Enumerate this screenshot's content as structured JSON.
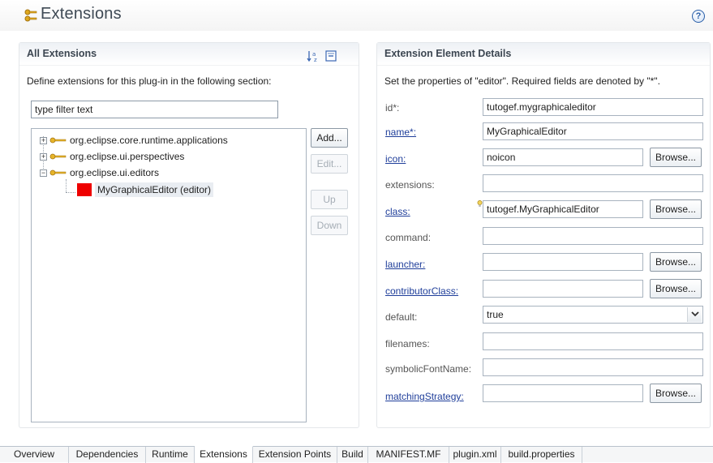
{
  "header": {
    "title": "Extensions",
    "help_icon": "help-icon"
  },
  "left": {
    "heading": "All Extensions",
    "description": "Define extensions for this plug-in in the following section:",
    "filter_value": "type filter text",
    "tree": {
      "items": [
        {
          "label": "org.eclipse.core.runtime.applications",
          "expanded": false
        },
        {
          "label": "org.eclipse.ui.perspectives",
          "expanded": false
        },
        {
          "label": "org.eclipse.ui.editors",
          "expanded": true
        }
      ],
      "child": {
        "label": "MyGraphicalEditor (editor)",
        "icon_color": "#ee0000"
      }
    },
    "buttons": {
      "add": "Add...",
      "edit": "Edit...",
      "up": "Up",
      "down": "Down"
    }
  },
  "right": {
    "heading": "Extension Element Details",
    "description": "Set the properties of \"editor\". Required fields are denoted by \"*\".",
    "fields": [
      {
        "label": "id*:",
        "value": "tutogef.mygraphicaleditor"
      },
      {
        "label": "name*:",
        "value": "MyGraphicalEditor"
      },
      {
        "label": "icon:",
        "value": "noicon"
      },
      {
        "label": "extensions:",
        "value": ""
      },
      {
        "label": "class:",
        "value": "tutogef.MyGraphicalEditor"
      },
      {
        "label": "command:",
        "value": ""
      },
      {
        "label": "launcher:",
        "value": ""
      },
      {
        "label": "contributorClass:",
        "value": ""
      },
      {
        "label": "default:",
        "value": "true"
      },
      {
        "label": "filenames:",
        "value": ""
      },
      {
        "label": "symbolicFontName:",
        "value": ""
      },
      {
        "label": "matchingStrategy:",
        "value": ""
      }
    ],
    "browse_label": "Browse..."
  },
  "tabs": [
    "Overview",
    "Dependencies",
    "Runtime",
    "Extensions",
    "Extension Points",
    "Build",
    "MANIFEST.MF",
    "plugin.xml",
    "build.properties"
  ],
  "active_tab": "Extensions",
  "colors": {
    "link": "#1f3e9a",
    "accent_icon": "#d9a21b"
  }
}
